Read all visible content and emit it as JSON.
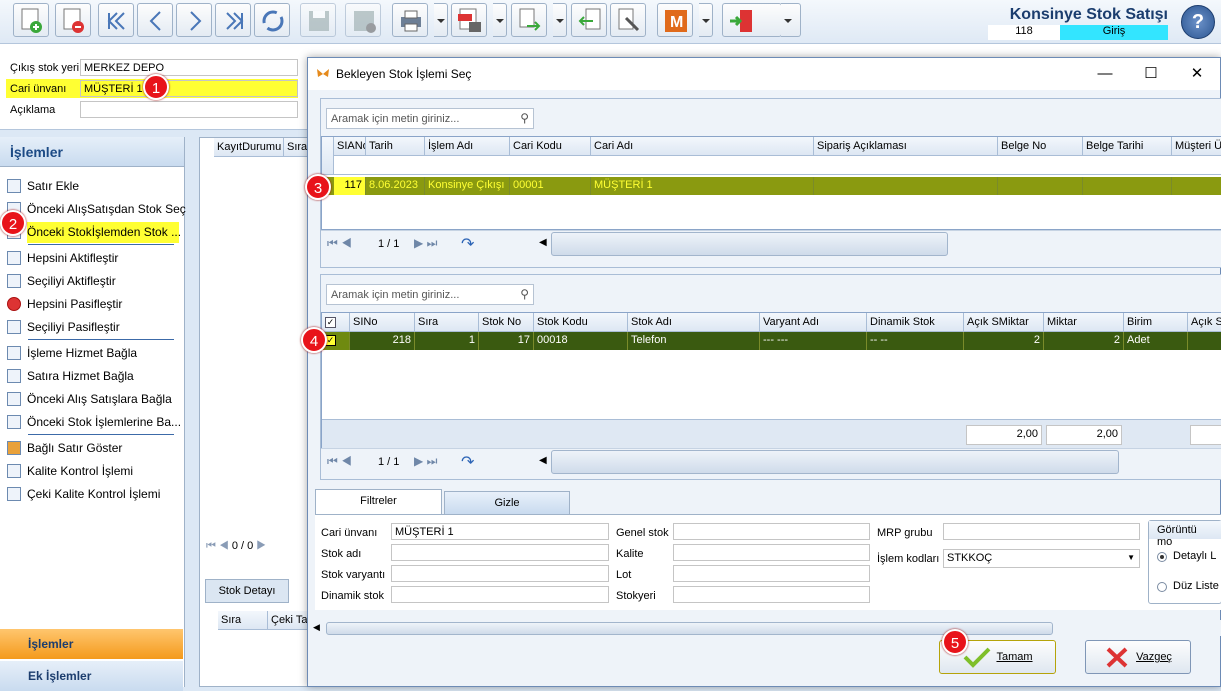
{
  "app": {
    "title": "Konsinye Stok Satışı",
    "record_number": "118",
    "mode": "Giriş"
  },
  "form": {
    "cikis_label": "Çıkış stok yeri",
    "cikis_value": "MERKEZ DEPO",
    "cari_label": "Cari ünvanı",
    "cari_value": "MÜŞTERİ 1",
    "aciklama_label": "Açıklama",
    "aciklama_value": ""
  },
  "left_panel": {
    "header": "İşlemler",
    "items": [
      "Satır Ekle",
      "Önceki AlışSatışdan Stok Seç",
      "Önceki Stokİşlemden Stok ...",
      "Hepsini Aktifleştir",
      "Seçiliyi Aktifleştir",
      "Hepsini Pasifleştir",
      "Seçiliyi Pasifleştir",
      "İşleme Hizmet Bağla",
      "Satıra Hizmet Bağla",
      "Önceki Alış Satışlara Bağla",
      "Önceki Stok İşlemlerine Ba...",
      "Bağlı Satır Göster",
      "Kalite Kontrol İşlemi",
      "Çeki Kalite Kontrol İşlemi"
    ],
    "nav_islemler": "İşlemler",
    "nav_ek": "Ek İşlemler"
  },
  "background_grid": {
    "col1": "KayıtDurumu",
    "col2": "Sıra",
    "pager": "0 / 0",
    "tab": "Stok Detayı",
    "col3": "Sıra",
    "col4": "Çeki Tak"
  },
  "dialog": {
    "title": "Bekleyen Stok İşlemi Seç",
    "search_placeholder": "Aramak için metin giriniz...",
    "top_grid": {
      "columns": [
        "SIANo",
        "Tarih",
        "İşlem Adı",
        "Cari Kodu",
        "Cari Adı",
        "Sipariş Açıklaması",
        "Belge No",
        "Belge Tarihi",
        "Müşteri Ü"
      ],
      "row": [
        "117",
        "8.06.2023",
        "Konsinye Çıkışı",
        "00001",
        "MÜŞTERİ 1",
        "",
        "",
        "",
        ""
      ],
      "pager": "1 / 1"
    },
    "bottom_grid": {
      "columns": [
        "SINo",
        "Sıra",
        "Stok No",
        "Stok Kodu",
        "Stok Adı",
        "Varyant Adı",
        "Dinamik Stok",
        "Açık SMiktar",
        "Miktar",
        "Birim",
        "Açık S"
      ],
      "row": [
        "218",
        "1",
        "17",
        "00018",
        "Telefon",
        "--- ---",
        "-- --",
        "2",
        "2",
        "Adet",
        ""
      ],
      "sum1": "2,00",
      "sum2": "2,00",
      "pager": "1 / 1"
    },
    "tabs": {
      "filtreler": "Filtreler",
      "gizle": "Gizle"
    },
    "filters": {
      "cari_label": "Cari ünvanı",
      "cari_value": "MÜŞTERİ 1",
      "stok_adi_label": "Stok adı",
      "stok_varyanti_label": "Stok varyantı",
      "dinamik_stok_label": "Dinamik stok",
      "genel_stok_label": "Genel stok",
      "kalite_label": "Kalite",
      "lot_label": "Lot",
      "stokyeri_label": "Stokyeri",
      "mrp_label": "MRP grubu",
      "islem_kodlari_label": "İşlem kodları",
      "islem_kodlari_value": "STKKOÇ",
      "gorunum_label": "Görüntü mo",
      "radio1": "Detaylı L",
      "radio2": "Düz Liste"
    },
    "ok_label": "Tamam",
    "cancel_label": "Vazgeç"
  },
  "badges": [
    "1",
    "2",
    "3",
    "4",
    "5"
  ],
  "colors": {
    "highlight": "#ffff33",
    "row_selected": "#8a9a10",
    "row_dark": "#3a5a10",
    "accent": "#1b3d6e",
    "badge": "#e8131a"
  }
}
